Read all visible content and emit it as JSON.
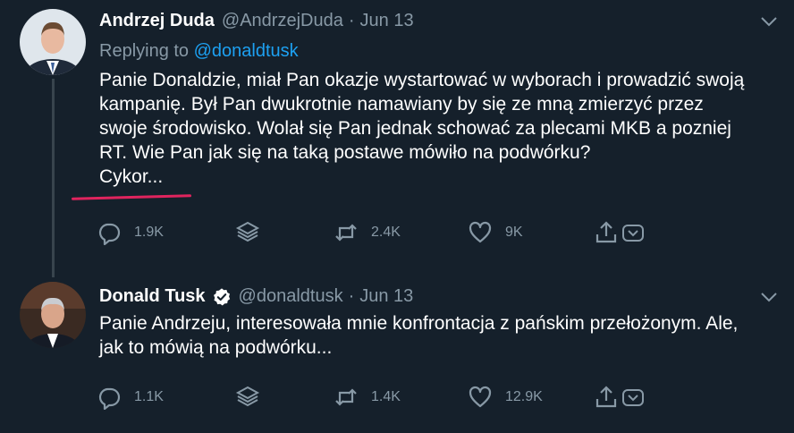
{
  "tweets": [
    {
      "name": "Andrzej Duda",
      "handle": "@AndrzejDuda",
      "separator": "·",
      "date": "Jun 13",
      "replying_prefix": "Replying to ",
      "replying_to": "@donaldtusk",
      "text": "Panie Donaldzie, miał Pan okazje wystartować w wyborach i prowadzić swoją\nkampanię. Był Pan dwukrotnie namawiany by się ze mną zmierzyć przez\nswoje środowisko. Wolał się Pan jednak schować za plecami MKB a pozniej\nRT. Wie Pan jak się na taką postawe mówiło na podwórku?\nCykor...",
      "replies": "1.9K",
      "retweets": "2.4K",
      "likes": "9K",
      "verified": false
    },
    {
      "name": "Donald Tusk",
      "handle": "@donaldtusk",
      "separator": "·",
      "date": "Jun 13",
      "text": "Panie Andrzeju, interesowała mnie konfrontacja z pańskim przełożonym. Ale,\njak to mówią na podwórku...",
      "replies": "1.1K",
      "retweets": "1.4K",
      "likes": "12.9K",
      "verified": true
    }
  ],
  "colors": {
    "background": "#15202b",
    "secondary_text": "#8899a6",
    "link": "#1da1f2",
    "annotation_underline": "#e0245e",
    "thread_line": "#38444d"
  },
  "icons": [
    "reply-icon",
    "stack-icon",
    "retweet-icon",
    "like-icon",
    "share-icon",
    "chevron-down-icon",
    "verified-icon"
  ]
}
